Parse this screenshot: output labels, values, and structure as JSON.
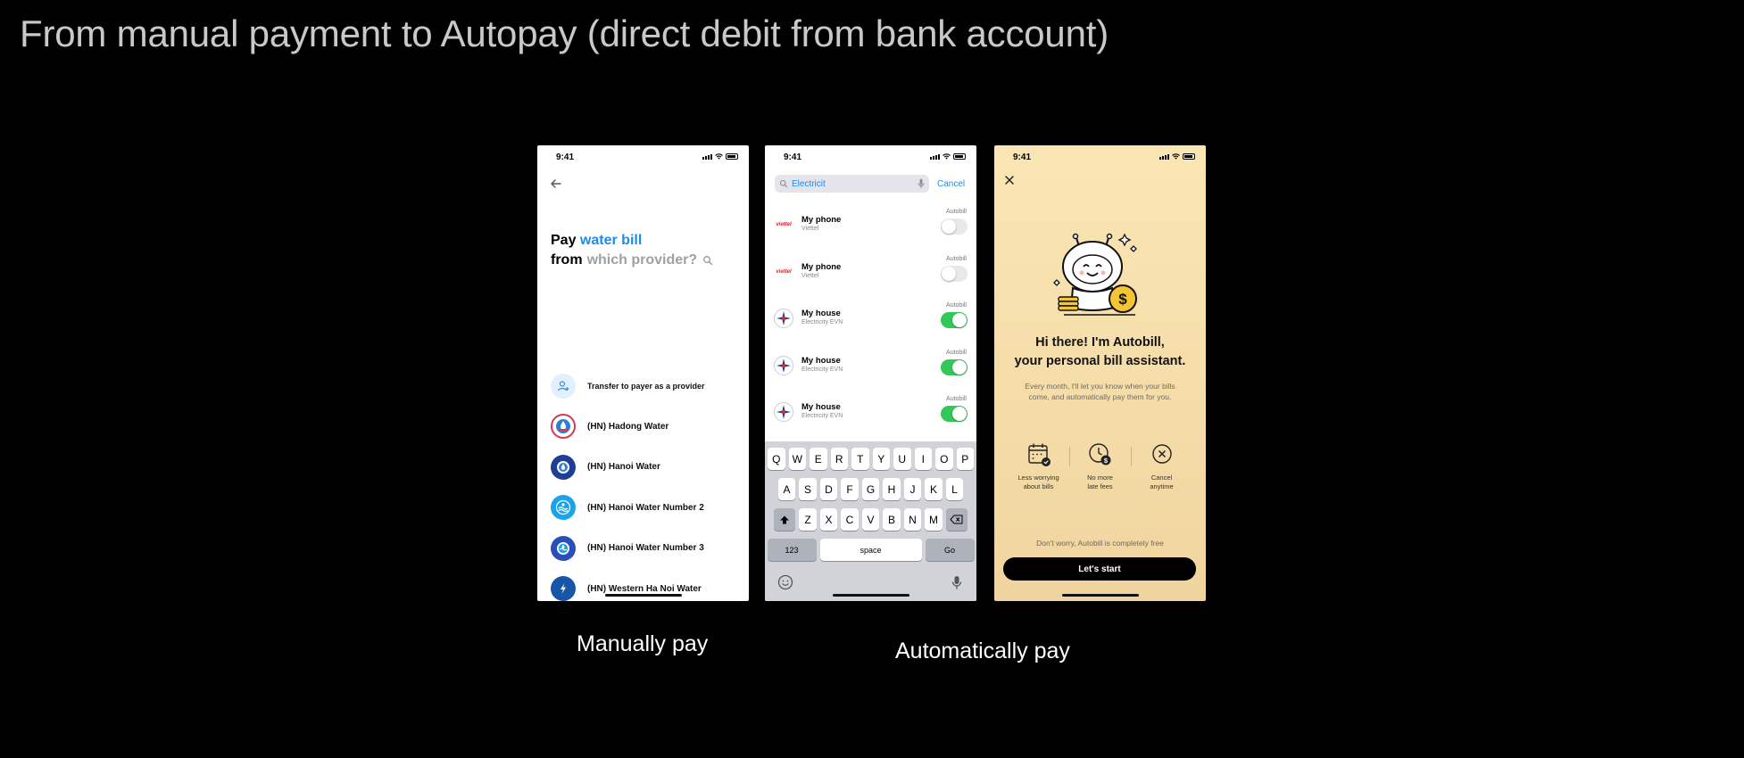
{
  "slide": {
    "title": "From manual payment to Autopay (direct debit from bank account)",
    "caption_manual": "Manually pay",
    "caption_auto": "Automatically pay"
  },
  "status_time": "9:41",
  "manual_screen": {
    "pay_word": "Pay",
    "bill_type": "water bill",
    "from_word": "from",
    "provider_placeholder": "which provider?",
    "providers": [
      {
        "name": "Transfer to payer as a provider",
        "icon": "person-add-icon"
      },
      {
        "name": "(HN) Hadong Water",
        "icon": "hadong-water-logo"
      },
      {
        "name": "(HN) Hanoi Water",
        "icon": "hanoi-water-logo"
      },
      {
        "name": "(HN) Hanoi Water Number 2",
        "icon": "hanoi-water-2-logo"
      },
      {
        "name": "(HN) Hanoi Water Number 3",
        "icon": "hanoi-water-3-logo"
      },
      {
        "name": "(HN) Western Ha Noi Water",
        "icon": "western-hanoi-water-logo"
      }
    ]
  },
  "search_screen": {
    "search_value": "Electricit",
    "cancel_label": "Cancel",
    "bills": [
      {
        "title": "My phone",
        "provider": "Viettel",
        "logo_text": "viettel",
        "autobill_label": "Autobill",
        "autobill_on": false
      },
      {
        "title": "My phone",
        "provider": "Viettel",
        "logo_text": "viettel",
        "autobill_label": "Autobill",
        "autobill_on": false
      },
      {
        "title": "My house",
        "provider": "Electricity EVN",
        "logo_text": "",
        "autobill_label": "Autobill",
        "autobill_on": true
      },
      {
        "title": "My house",
        "provider": "Electricity EVN",
        "logo_text": "",
        "autobill_label": "Autobill",
        "autobill_on": true
      },
      {
        "title": "My house",
        "provider": "Electricity EVN",
        "logo_text": "",
        "autobill_label": "Autobill",
        "autobill_on": true
      }
    ],
    "keyboard": {
      "row1": [
        "Q",
        "W",
        "E",
        "R",
        "T",
        "Y",
        "U",
        "I",
        "O",
        "P"
      ],
      "row2": [
        "A",
        "S",
        "D",
        "F",
        "G",
        "H",
        "J",
        "K",
        "L"
      ],
      "row3": [
        "Z",
        "X",
        "C",
        "V",
        "B",
        "N",
        "M"
      ],
      "numbers_label": "123",
      "space_label": "space",
      "go_label": "Go"
    }
  },
  "autobill_screen": {
    "title_line1": "Hi there! I'm Autobill,",
    "title_line2": "your personal bill assistant.",
    "description": "Every month, I'll let you know when your bills come, and automatically pay them for you.",
    "features": [
      {
        "label_line1": "Less worrying",
        "label_line2": "about bills",
        "icon": "calendar-check-icon"
      },
      {
        "label_line1": "No more",
        "label_line2": "late fees",
        "icon": "clock-dollar-icon"
      },
      {
        "label_line1": "Cancel",
        "label_line2": "anytime",
        "icon": "cancel-circle-icon"
      }
    ],
    "free_note": "Don't worry, Autobill is completely free",
    "start_label": "Let's start"
  },
  "colors": {
    "accent_blue": "#1a8cf0",
    "toggle_on": "#34c759",
    "viettel_red": "#e3242b",
    "autobill_bg": "#fae6b4"
  }
}
